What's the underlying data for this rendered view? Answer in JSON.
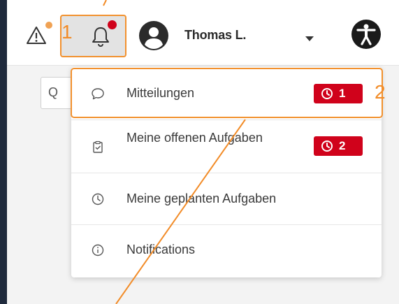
{
  "header": {
    "user_name": "Thomas L.",
    "icons": [
      "warning-icon",
      "bell-icon",
      "user-avatar-icon",
      "caret-down-icon",
      "accessibility-icon"
    ]
  },
  "annotations": {
    "callout_1": "1",
    "callout_2": "2",
    "color": "#f28c28"
  },
  "search": {
    "icon": "search-icon",
    "glyph": "Q"
  },
  "dropdown": {
    "items": [
      {
        "label": "Mitteilungen",
        "icon": "chat-bubble-icon",
        "badge": "1",
        "badge_icon": "clock-icon"
      },
      {
        "label": "Meine offenen Aufgaben",
        "icon": "clipboard-check-icon",
        "badge": "2",
        "badge_icon": "clock-icon"
      },
      {
        "label": "Meine geplanten Aufgaben",
        "icon": "clock-icon"
      },
      {
        "label": "Notifications",
        "icon": "info-icon"
      }
    ]
  },
  "colors": {
    "badge": "#d0021b",
    "warning_dot": "#f0a254",
    "highlight": "#f2912e"
  }
}
